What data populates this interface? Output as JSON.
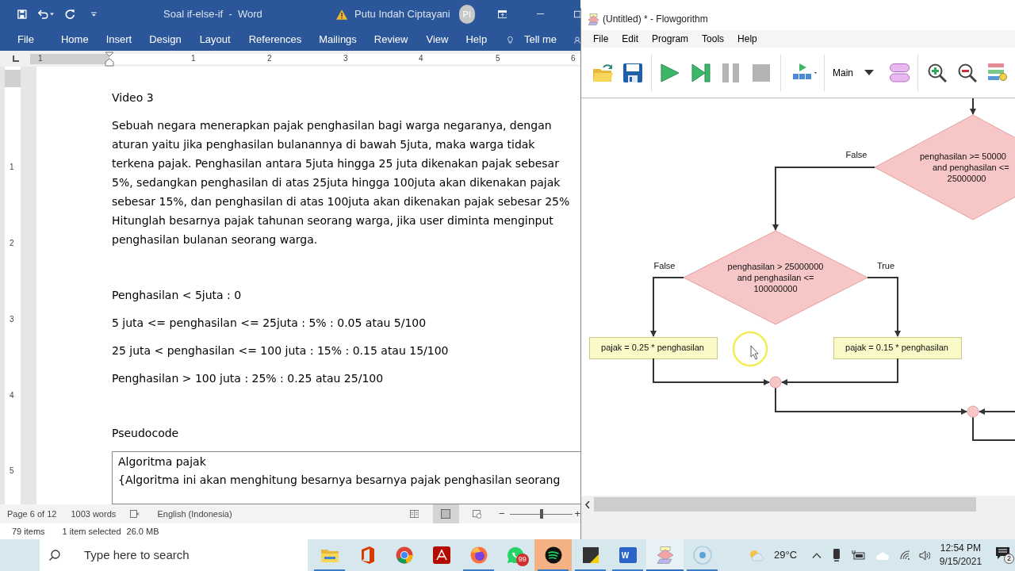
{
  "word": {
    "title": "Soal if-else-if  -  Word",
    "user": "Putu Indah Ciptayani",
    "avatar": "PI",
    "tabs": [
      "File",
      "Home",
      "Insert",
      "Design",
      "Layout",
      "References",
      "Mailings",
      "Review",
      "View",
      "Help"
    ],
    "tell_me": "Tell me",
    "ruler_h": [
      "1",
      "1",
      "2",
      "3",
      "4",
      "5",
      "6"
    ],
    "ruler_v": [
      "1",
      "2",
      "3",
      "4",
      "5"
    ],
    "document": {
      "heading": "Video 3",
      "paragraph": [
        "Sebuah negara menerapkan pajak penghasilan bagi warga negaranya, dengan",
        "aturan yaitu jika penghasilan bulanannya di bawah 5juta, maka warga tidak",
        "terkena pajak. Penghasilan antara 5juta hingga 25 juta dikenakan pajak sebesar",
        "5%, sedangkan penghasilan di atas 25juta hingga 100juta akan dikenakan pajak",
        "sebesar 15%, dan penghasilan di atas 100juta akan dikenakan pajak sebesar 25%",
        "Hitunglah besarnya pajak tahunan seorang warga, jika user diminta menginput",
        "penghasilan bulanan seorang warga."
      ],
      "rules": [
        "Penghasilan < 5juta : 0",
        "5 juta <= penghasilan <= 25juta : 5% : 0.05 atau 5/100",
        "25 juta < penghasilan <= 100 juta : 15% : 0.15 atau 15/100",
        "Penghasilan > 100 juta : 25% : 0.25 atau 25/100"
      ],
      "pseudocode_heading": "Pseudocode",
      "code_lines": [
        "Algoritma pajak",
        "{Algoritma ini akan menghitung besarnya besarnya pajak penghasilan seorang"
      ]
    },
    "status": {
      "page": "Page 6 of 12",
      "words": "1003 words",
      "language": "English (Indonesia)",
      "zoom_minus": "−",
      "zoom_plus": "+",
      "zoom": {
        "level": 0.5
      }
    }
  },
  "explorer": {
    "items": "79 items",
    "selected": "1 item selected",
    "size": "26.0 MB"
  },
  "flowgorithm": {
    "title": "(Untitled) * - Flowgorithm",
    "menu": [
      "File",
      "Edit",
      "Program",
      "Tools",
      "Help"
    ],
    "function": "Main",
    "nodes": [
      {
        "kind": "decision",
        "lines": [
          "penghasilan >= 50000",
          "and penghasilan <=",
          "25000000"
        ]
      },
      {
        "kind": "decision",
        "lines": [
          "penghasilan > 25000000",
          "and penghasilan <=",
          "100000000"
        ]
      },
      {
        "kind": "process",
        "lines": [
          "pajak = 0.25 * penghasilan"
        ]
      },
      {
        "kind": "process",
        "lines": [
          "pajak = 0.15 * penghasilan"
        ]
      }
    ],
    "labels": [
      "False",
      "False",
      "True"
    ]
  },
  "taskbar": {
    "search_placeholder": "Type here to search",
    "apps": [
      {
        "kind": "explorer",
        "running": true,
        "selected": false,
        "hover": false
      },
      {
        "kind": "office",
        "running": false,
        "selected": false,
        "hover": false
      },
      {
        "kind": "chrome",
        "running": false,
        "selected": false,
        "hover": false
      },
      {
        "kind": "acrobat",
        "running": false,
        "selected": false,
        "hover": false
      },
      {
        "kind": "firefox",
        "running": true,
        "selected": false,
        "hover": false
      },
      {
        "kind": "whatsapp",
        "running": false,
        "selected": false,
        "hover": false,
        "badge": "99"
      },
      {
        "kind": "spotify",
        "running": true,
        "selected": false,
        "hover": true
      },
      {
        "kind": "sticky",
        "running": true,
        "selected": false,
        "hover": false
      },
      {
        "kind": "word",
        "running": true,
        "selected": false,
        "hover": false,
        "letter": "W"
      },
      {
        "kind": "flowgorithm",
        "running": true,
        "selected": true,
        "hover": false
      },
      {
        "kind": "recorder",
        "running": true,
        "selected": false,
        "hover": false
      }
    ],
    "temperature": "29°C",
    "time": "12:54 PM",
    "date": "9/15/2021",
    "notifications": "2"
  }
}
